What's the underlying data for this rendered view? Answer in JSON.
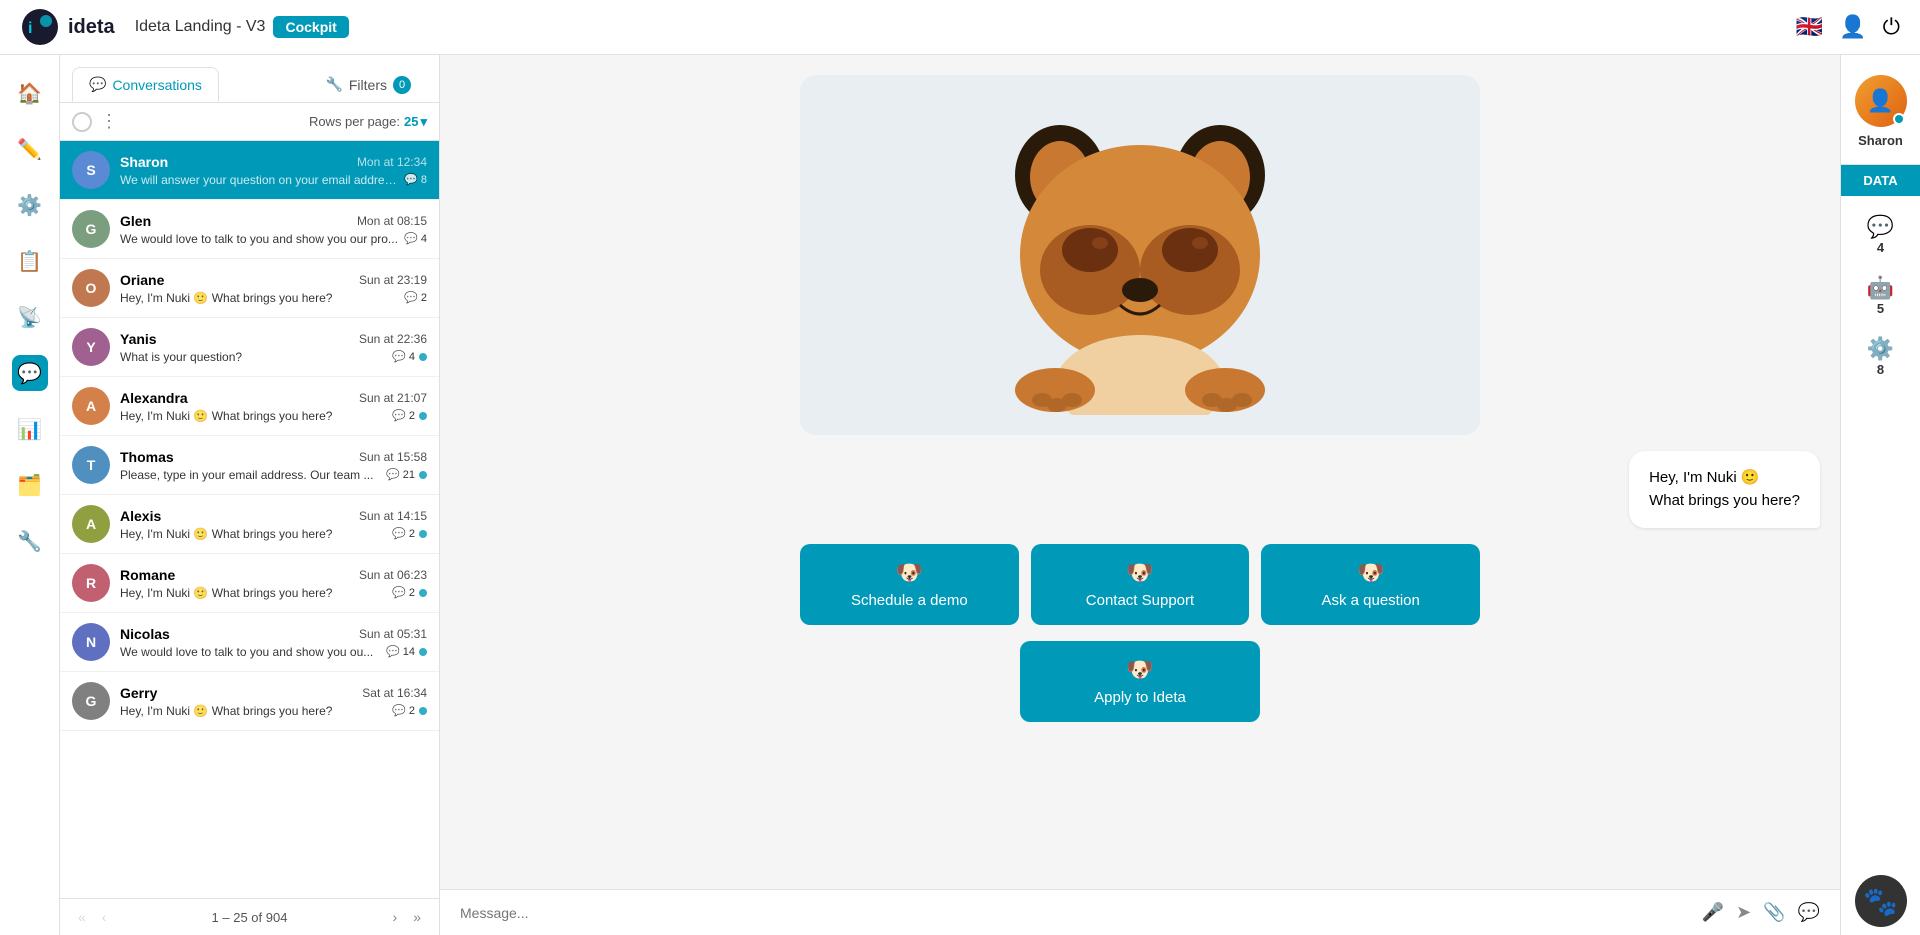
{
  "app": {
    "logo_text": "ideta",
    "title": "Ideta Landing - V3",
    "badge": "Cockpit"
  },
  "topbar": {
    "lang_icon": "🇬🇧",
    "user_icon": "👤",
    "power_icon": "⏻"
  },
  "conversations": {
    "tab_label": "Conversations",
    "tab_icon": "💬",
    "filter_label": "Filters",
    "filter_icon": "🔧",
    "filter_count": "0",
    "rows_label": "Rows per page:",
    "rows_value": "25",
    "pagination": "1 – 25 of 904",
    "items": [
      {
        "name": "Sharon",
        "time": "Mon at 12:34",
        "preview": "We will answer your question on your email addres...",
        "count": "8",
        "dot": false,
        "selected": true,
        "initials": "S",
        "color": "av-sharon"
      },
      {
        "name": "Glen",
        "time": "Mon at 08:15",
        "preview": "We would love to talk to you and show you our pro...",
        "count": "4",
        "dot": false,
        "selected": false,
        "initials": "G",
        "color": "av-glen"
      },
      {
        "name": "Oriane",
        "time": "Sun at 23:19",
        "preview": "Hey, I'm Nuki 🙂 What brings you here?",
        "count": "2",
        "dot": false,
        "selected": false,
        "initials": "O",
        "color": "av-oriane"
      },
      {
        "name": "Yanis",
        "time": "Sun at 22:36",
        "preview": "What is your question?",
        "count": "4",
        "dot": true,
        "selected": false,
        "initials": "Y",
        "color": "av-yanis"
      },
      {
        "name": "Alexandra",
        "time": "Sun at 21:07",
        "preview": "Hey, I'm Nuki 🙂 What brings you here?",
        "count": "2",
        "dot": true,
        "selected": false,
        "initials": "A",
        "color": "av-alexandra"
      },
      {
        "name": "Thomas",
        "time": "Sun at 15:58",
        "preview": "Please, type in your email address. Our team ...",
        "count": "21",
        "dot": true,
        "selected": false,
        "initials": "T",
        "color": "av-thomas"
      },
      {
        "name": "Alexis",
        "time": "Sun at 14:15",
        "preview": "Hey, I'm Nuki 🙂 What brings you here?",
        "count": "2",
        "dot": true,
        "selected": false,
        "initials": "A",
        "color": "av-alexis"
      },
      {
        "name": "Romane",
        "time": "Sun at 06:23",
        "preview": "Hey, I'm Nuki 🙂 What brings you here?",
        "count": "2",
        "dot": true,
        "selected": false,
        "initials": "R",
        "color": "av-romane"
      },
      {
        "name": "Nicolas",
        "time": "Sun at 05:31",
        "preview": "We would love to talk to you and show you ou...",
        "count": "14",
        "dot": true,
        "selected": false,
        "initials": "N",
        "color": "av-nicolas"
      },
      {
        "name": "Gerry",
        "time": "Sat at 16:34",
        "preview": "Hey, I'm Nuki 🙂 What brings you here?",
        "count": "2",
        "dot": true,
        "selected": false,
        "initials": "G",
        "color": "av-gerry"
      }
    ]
  },
  "chat": {
    "greeting_line1": "Hey, I'm Nuki 🙂",
    "greeting_line2": "What brings you here?",
    "input_placeholder": "Message...",
    "buttons": [
      {
        "icon": "🐶",
        "label": "Schedule a demo"
      },
      {
        "icon": "🐶",
        "label": "Contact Support"
      },
      {
        "icon": "🐶",
        "label": "Ask a question"
      },
      {
        "icon": "🐶",
        "label": "Apply to Ideta"
      }
    ]
  },
  "right_panel": {
    "user_name": "Sharon",
    "data_tab": "DATA",
    "stats": [
      {
        "icon": "💬",
        "count": "4"
      },
      {
        "icon": "🤖",
        "count": "5"
      },
      {
        "icon": "⚙️",
        "count": "8"
      }
    ]
  },
  "sidebar": {
    "items": [
      {
        "icon": "🏠",
        "label": "home",
        "active": false
      },
      {
        "icon": "✏️",
        "label": "edit",
        "active": false
      },
      {
        "icon": "⚙️",
        "label": "settings",
        "active": false
      },
      {
        "icon": "📋",
        "label": "list",
        "active": false
      },
      {
        "icon": "📡",
        "label": "broadcast",
        "active": false
      },
      {
        "icon": "💬",
        "label": "chat",
        "active": true
      },
      {
        "icon": "📊",
        "label": "analytics",
        "active": false
      },
      {
        "icon": "🗂️",
        "label": "stack",
        "active": false
      },
      {
        "icon": "🔧",
        "label": "config",
        "active": false
      }
    ]
  }
}
